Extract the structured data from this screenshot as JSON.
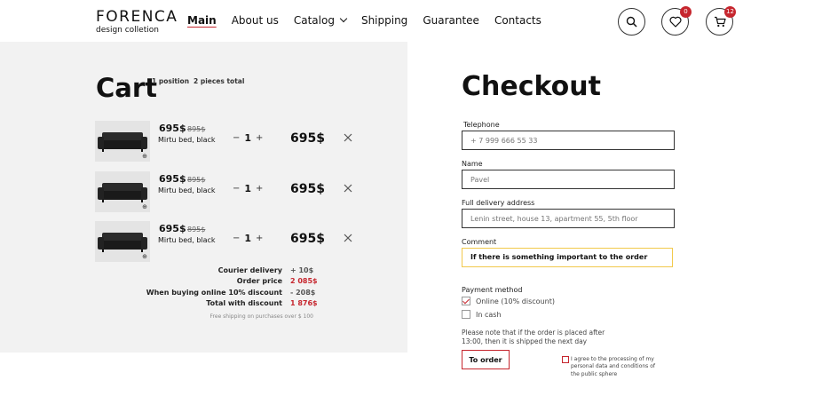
{
  "header": {
    "logo_name": "FORENCA",
    "logo_sub": "design colletion",
    "nav": [
      {
        "label": "Main"
      },
      {
        "label": "About us"
      },
      {
        "label": "Catalog"
      },
      {
        "label": "Shipping"
      },
      {
        "label": "Guarantee"
      },
      {
        "label": "Contacts"
      }
    ],
    "wishlist_count": "0",
    "cart_count": "12"
  },
  "cart": {
    "title": "Cart",
    "positions": "1 position",
    "pieces": "2 pieces total",
    "items": [
      {
        "price": "695$",
        "old_price": "895$",
        "name": "Mirtu bed, black",
        "qty": "1",
        "total": "695$"
      },
      {
        "price": "695$",
        "old_price": "895$",
        "name": "Mirtu bed, black",
        "qty": "1",
        "total": "695$"
      },
      {
        "price": "695$",
        "old_price": "895$",
        "name": "Mirtu bed, black",
        "qty": "1",
        "total": "695$"
      }
    ],
    "summary": [
      {
        "label": "Courier delivery",
        "value": "+ 10$",
        "color": "#555555"
      },
      {
        "label": "Order price",
        "value": "2 085$",
        "color": "#c6262e"
      },
      {
        "label": "When buying online 10% discount",
        "value": "- 208$",
        "color": "#555555"
      },
      {
        "label": "Total with discount",
        "value": "1 876$",
        "color": "#c6262e"
      }
    ],
    "free_shipping": "Free shipping on purchases over $ 100"
  },
  "checkout": {
    "title": "Checkout",
    "telephone_label": "Telephone",
    "telephone_placeholder": "+ 7 999 666 55 33",
    "name_label": "Name",
    "name_placeholder": "Pavel",
    "address_label": "Full delivery address",
    "address_placeholder": "Lenin street, house 13, apartment 55, 5th floor",
    "comment_label": "Comment",
    "comment_value": "If there is something important to the order",
    "payment_label": "Payment method",
    "payment_online": "Online (10% discount)",
    "payment_cash": "In cash",
    "note": "Please note that if the order is placed after 13:00, then it is shipped the next day",
    "order_button": "To order",
    "agree_text": "I agree to the processing of my personal data and conditions of the public sphere"
  },
  "colors": {
    "accent": "#c6262e",
    "panel": "#f2f2f2",
    "comment_border": "#f2c94c"
  }
}
